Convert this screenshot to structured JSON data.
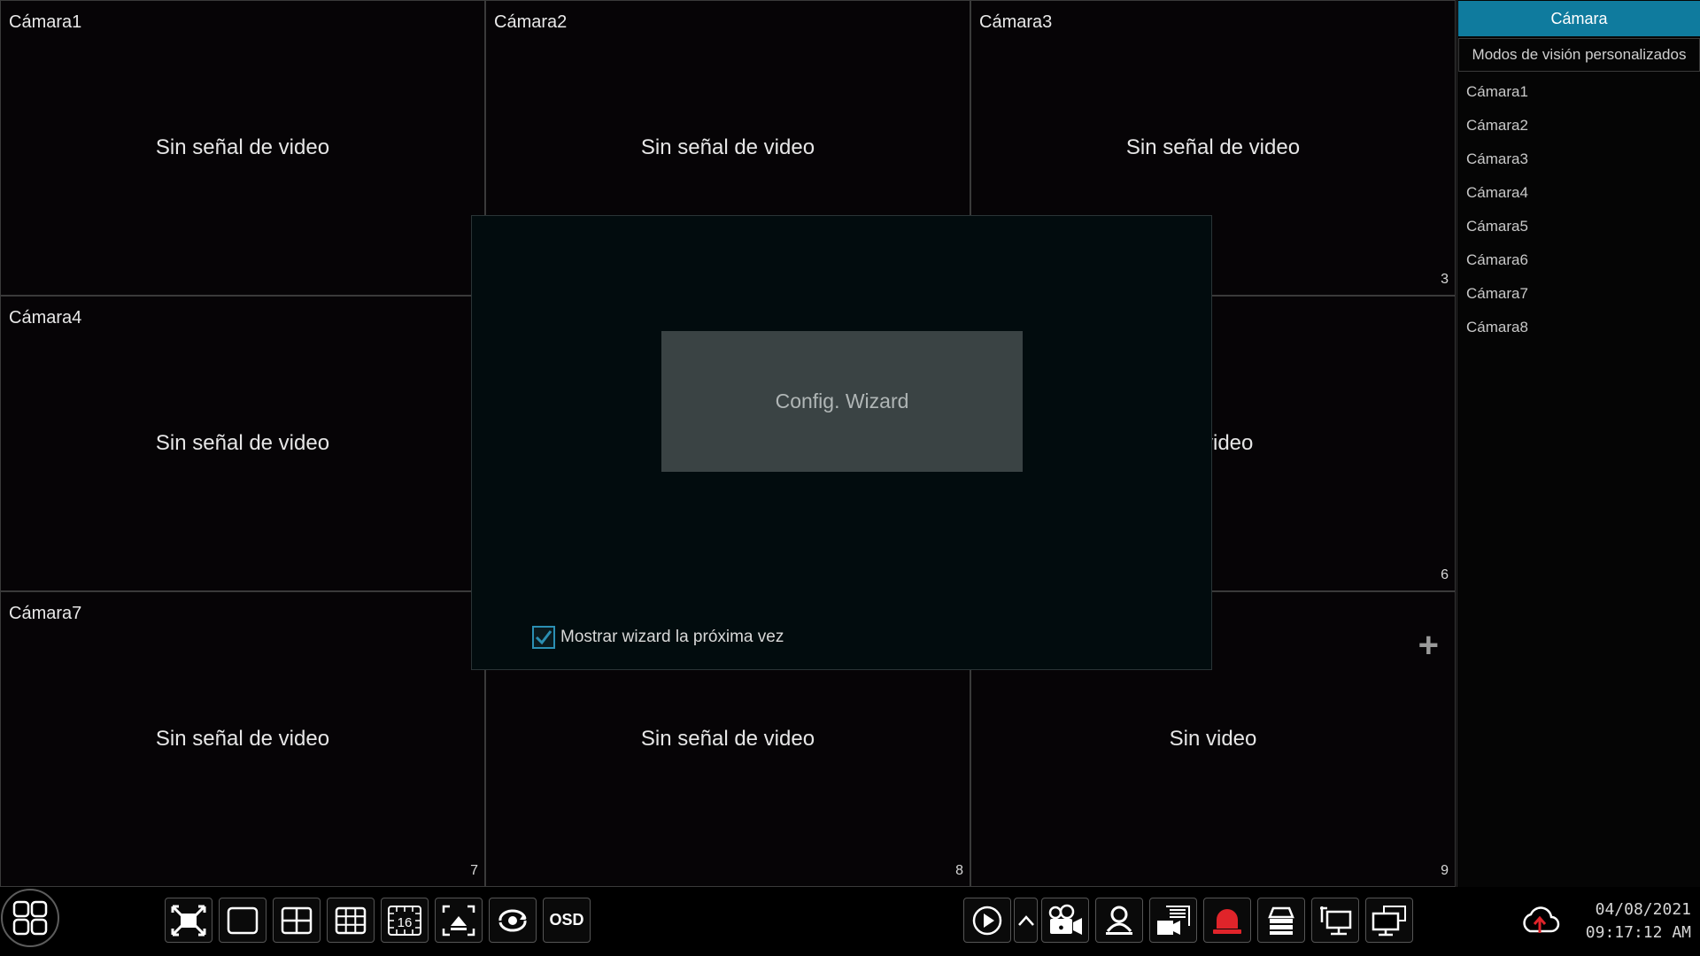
{
  "cameras": [
    {
      "title": "Cámara1",
      "status": "Sin señal de video",
      "channel": ""
    },
    {
      "title": "Cámara2",
      "status": "Sin señal de video",
      "channel": ""
    },
    {
      "title": "Cámara3",
      "status": "Sin señal de video",
      "channel": "3"
    },
    {
      "title": "Cámara4",
      "status": "Sin señal de video",
      "channel": ""
    },
    {
      "title": "",
      "status": "",
      "channel": ""
    },
    {
      "title": "",
      "status": "de video",
      "channel": "6"
    },
    {
      "title": "Cámara7",
      "status": "Sin señal de video",
      "channel": "7"
    },
    {
      "title": "",
      "status": "Sin señal de video",
      "channel": "8"
    },
    {
      "title": "",
      "status": "Sin video",
      "channel": "9"
    }
  ],
  "sidebar": {
    "tab_camera": "Cámara",
    "tab_custom": "Modos de visión personalizados",
    "items": [
      "Cámara1",
      "Cámara2",
      "Cámara3",
      "Cámara4",
      "Cámara5",
      "Cámara6",
      "Cámara7",
      "Cámara8"
    ]
  },
  "wizard": {
    "button_label": "Config. Wizard",
    "checkbox_label": "Mostrar wizard la próxima vez",
    "checkbox_checked": true
  },
  "taskbar": {
    "osd_label": "OSD",
    "date": "04/08/2021",
    "time": "09:17:12 AM",
    "icons": [
      "start-menu-icon",
      "fullscreen-icon",
      "layout-1-icon",
      "layout-4-icon",
      "layout-9-icon",
      "layout-16-icon",
      "sequence-icon",
      "rotate-icon",
      "osd-icon",
      "play-icon",
      "chevron-up-icon",
      "record-icon",
      "person-detection-icon",
      "snapshot-icon",
      "alarm-icon",
      "disk-icon",
      "network-icon",
      "display-icon",
      "cloud-upload-icon"
    ],
    "layout_16_label": "16"
  },
  "colors": {
    "accent": "#0f7b9e",
    "alarm": "#e0242a"
  }
}
